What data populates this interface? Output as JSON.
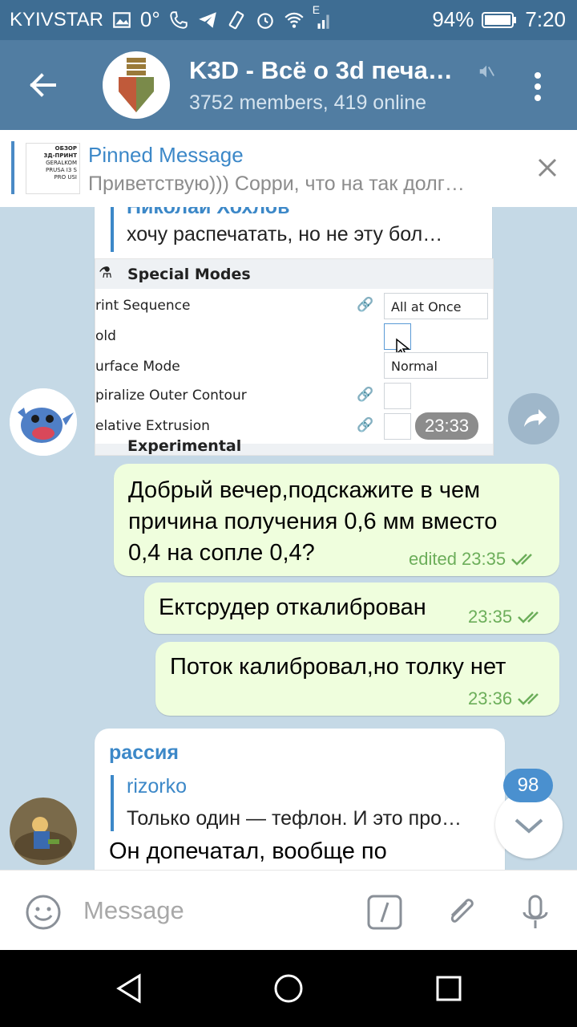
{
  "status_bar": {
    "carrier": "KYIVSTAR",
    "temperature": "0°",
    "network_label": "E",
    "battery": "94%",
    "time": "7:20"
  },
  "header": {
    "title": "K3D - Всё о 3d печа…",
    "subtitle": "3752 members, 419 online"
  },
  "pinned": {
    "title": "Pinned Message",
    "text": "Приветствую))) Сорри, что на так долг…",
    "thumb_lines": [
      "ОБЗОР",
      "3Д-ПРИНТ",
      "GERALKOM",
      "PRUSA I3 S",
      "PRO USI"
    ]
  },
  "messages": [
    {
      "type": "in",
      "cut_sender": "Николай Хохлов",
      "quote_text": "хочу распечатать, но не эту бол…",
      "time": "23:33",
      "screenshot": {
        "header": "Special Modes",
        "rows": [
          {
            "label": "rint Sequence",
            "value": "All at Once"
          },
          {
            "label": "old",
            "value": ""
          },
          {
            "label": "urface Mode",
            "value": "Normal"
          },
          {
            "label": "piralize Outer Contour",
            "value": ""
          },
          {
            "label": "elative Extrusion",
            "value": ""
          }
        ],
        "footer": "Experimental"
      }
    },
    {
      "type": "out",
      "text": [
        "Добрый вечер,подскажите в чем",
        "причина получения 0,6 мм вместо",
        "0,4 на сопле 0,4?"
      ],
      "meta": "edited 23:35"
    },
    {
      "type": "out",
      "text": [
        "Ектсрудер откалиброван"
      ],
      "meta": "23:35"
    },
    {
      "type": "out",
      "text": [
        "Поток калибровал,но толку нет"
      ],
      "meta": "23:36"
    },
    {
      "type": "in",
      "sender": "рассия",
      "quote_name": "rizorko",
      "quote_text": "Только один — тефлон. И это про…",
      "text": "Он допечатал, вообще по"
    }
  ],
  "unread_count": "98",
  "input": {
    "placeholder": "Message"
  },
  "colors": {
    "status_bar": "#3e6d93",
    "header": "#517da2",
    "accent": "#3c88c8",
    "out_bubble": "#effedd",
    "meta_green": "#6cae5a"
  }
}
